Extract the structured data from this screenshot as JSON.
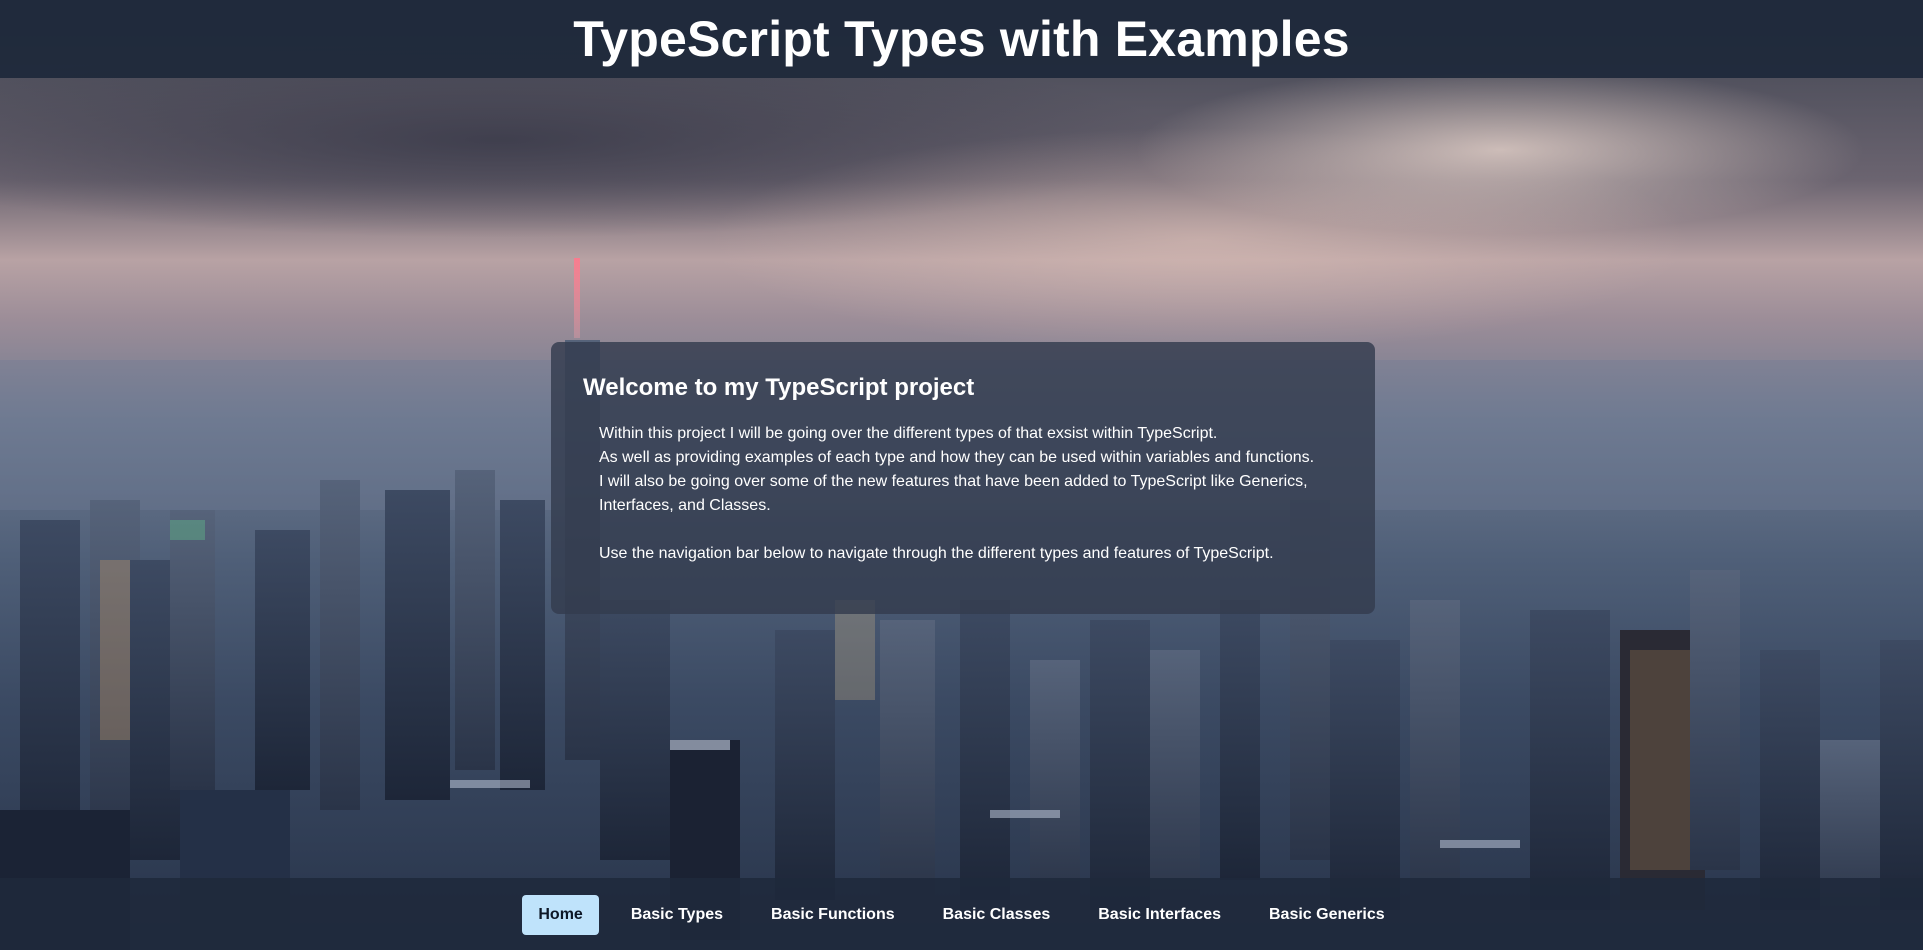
{
  "header": {
    "title": "TypeScript Types with Examples"
  },
  "welcome": {
    "heading": "Welcome to my TypeScript project",
    "line1": "Within this project I will be going over the different types of that exsist within TypeScript.",
    "line2": "As well as providing examples of each type and how they can be used within variables and functions.",
    "line3": "I will also be going over some of the new features that have been added to TypeScript like Generics, Interfaces, and Classes.",
    "line4": "Use the navigation bar below to navigate through the different types and features of TypeScript."
  },
  "nav": {
    "items": [
      {
        "label": "Home",
        "active": true
      },
      {
        "label": "Basic Types",
        "active": false
      },
      {
        "label": "Basic Functions",
        "active": false
      },
      {
        "label": "Basic Classes",
        "active": false
      },
      {
        "label": "Basic Interfaces",
        "active": false
      },
      {
        "label": "Basic Generics",
        "active": false
      }
    ]
  },
  "colors": {
    "header_bg": "#1f293b",
    "nav_active_bg": "#bfe3fb",
    "card_bg": "#333c4e"
  }
}
